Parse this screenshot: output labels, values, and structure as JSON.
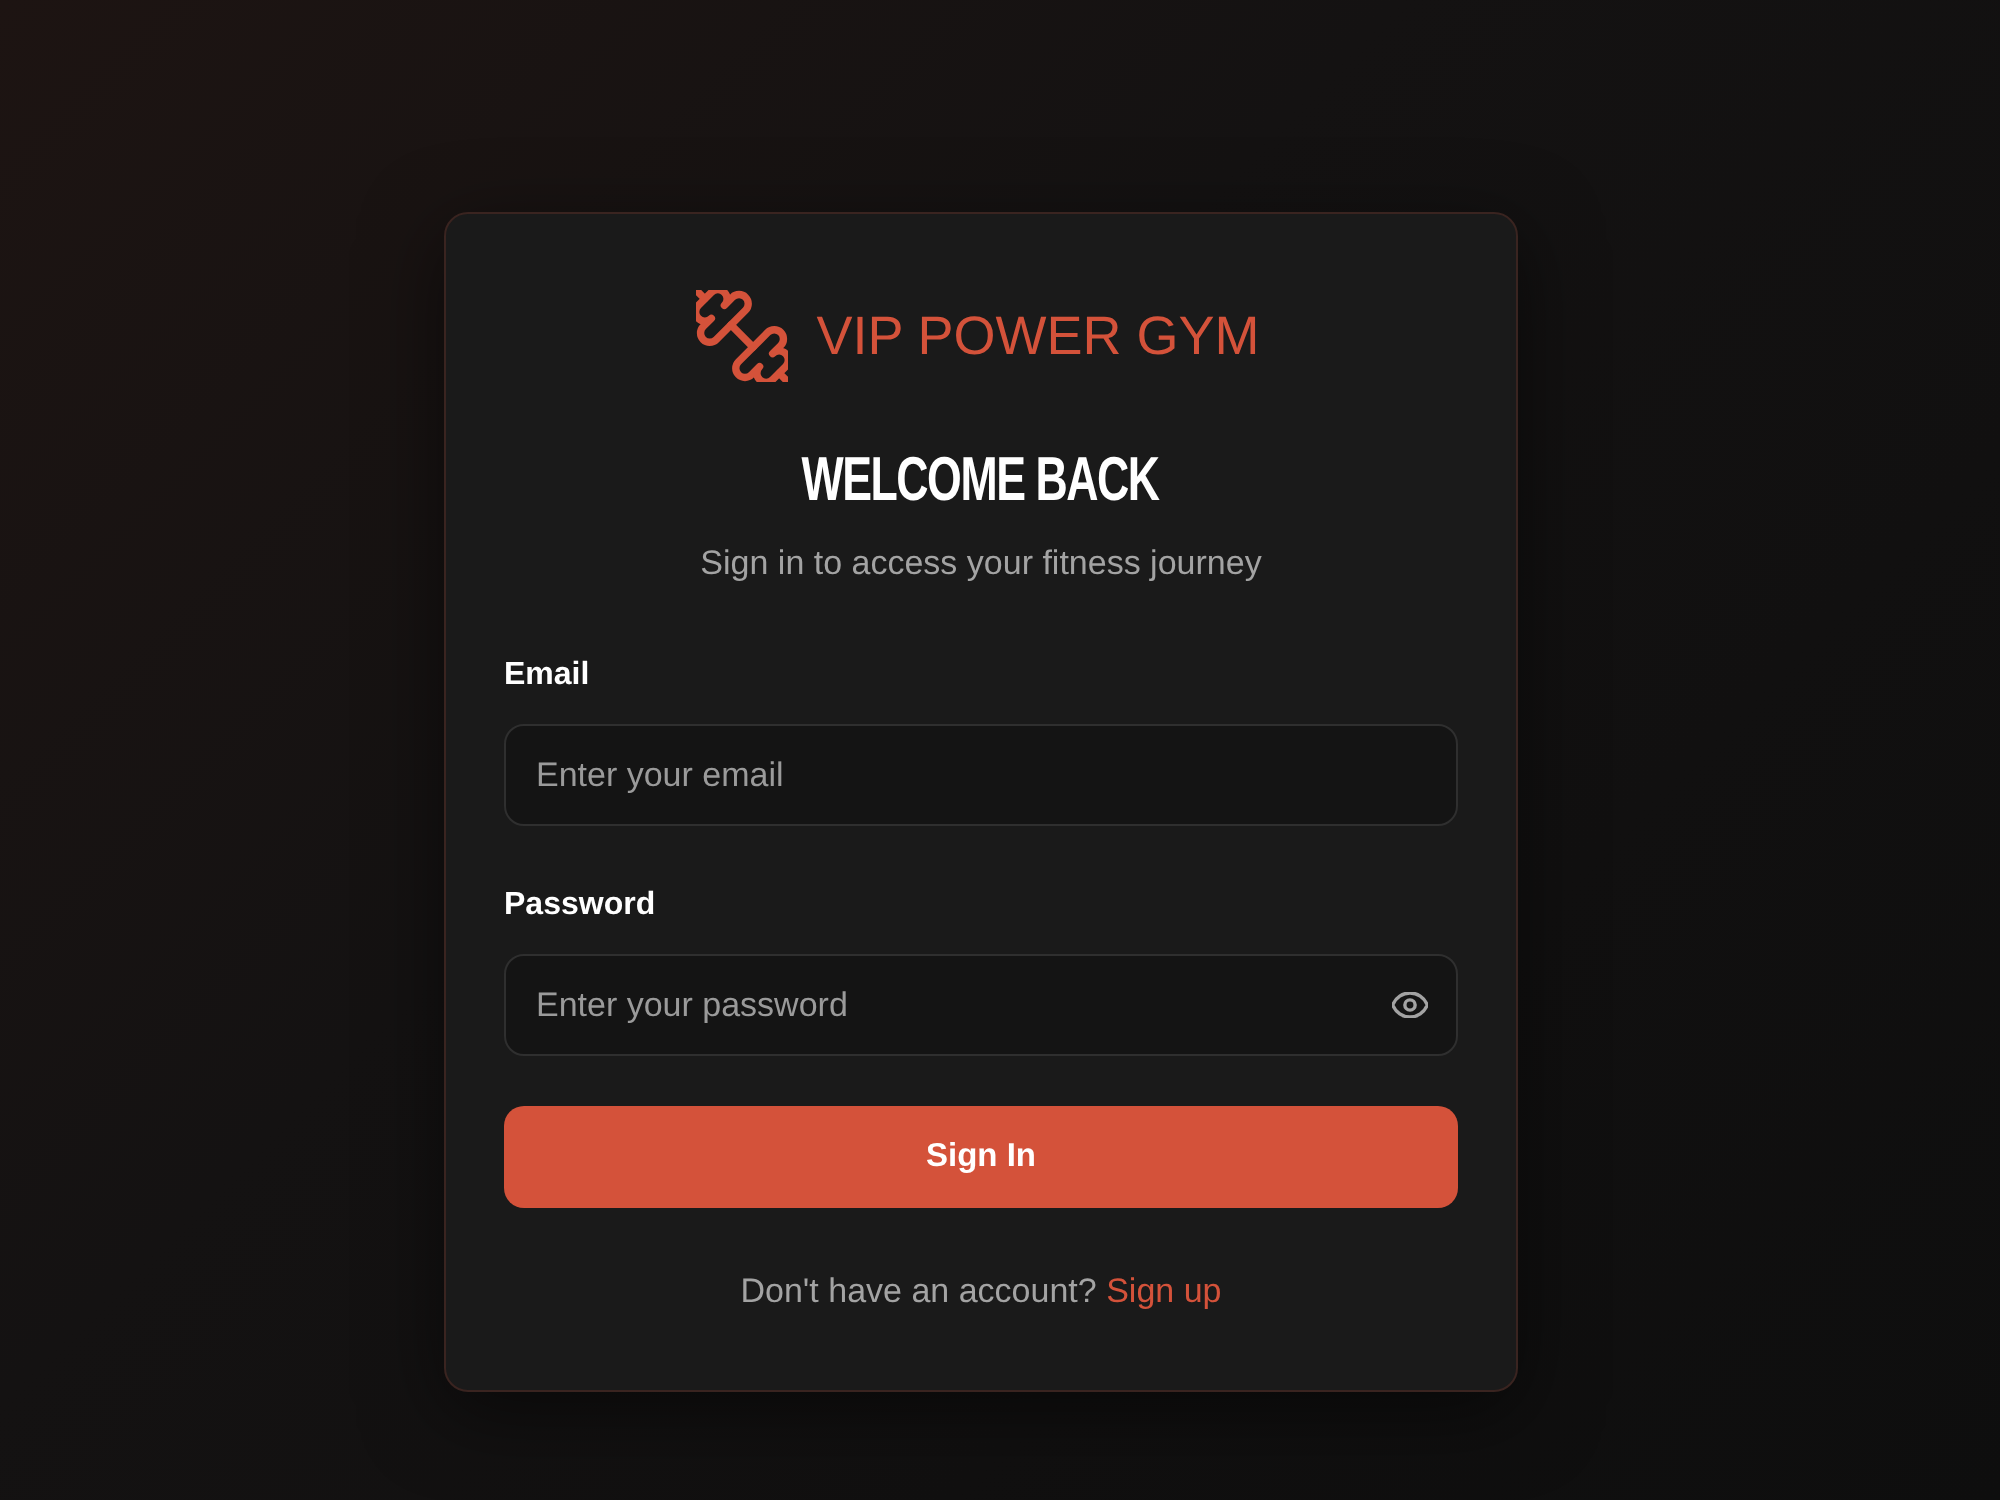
{
  "brand": {
    "name": "VIP POWER GYM"
  },
  "heading": {
    "title": "WELCOME BACK",
    "subtitle": "Sign in to access your fitness journey"
  },
  "fields": [
    {
      "kind": "email",
      "label": "Email",
      "placeholder": "Enter your email"
    },
    {
      "kind": "password",
      "label": "Password",
      "placeholder": "Enter your password"
    }
  ],
  "submit_button": {
    "label": "Sign In"
  },
  "footer": {
    "text": "Don't have an account?",
    "link": "Sign up"
  }
}
